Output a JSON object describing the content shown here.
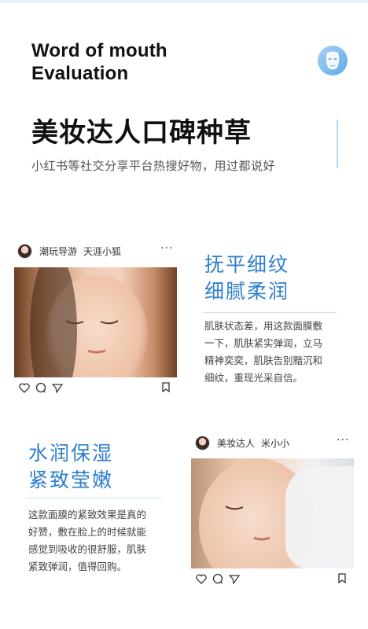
{
  "header": {
    "title_line1": "Word of mouth",
    "title_line2": "Evaluation",
    "icon": "face-mask-icon"
  },
  "hero": {
    "headline": "美妆达人口碑种草",
    "subhead": "小红书等社交分享平台热搜好物，用过都说好"
  },
  "post1": {
    "user": "潮玩导游",
    "name": "天涯小狐",
    "more": "···",
    "feature_line1": "抚平细纹",
    "feature_line2": "细腻柔润",
    "body_lines": [
      "肌肤状态差，用这款面膜敷",
      "一下，肌肤紧实弹润，立马",
      "精神奕奕，肌肤告别黯沉和",
      "细纹，重现光采自信。"
    ]
  },
  "post2": {
    "user": "美妆达人",
    "name": "米小小",
    "more": "···",
    "feature_line1": "水润保湿",
    "feature_line2": "紧致莹嫩",
    "body_lines": [
      "这款面膜的紧致效果是真的",
      "好赞，敷在脸上的时候就能",
      "感觉到吸收的很舒服，肌肤",
      "紧致弹润，值得回购。"
    ]
  },
  "colors": {
    "accent": "#2f7fd0",
    "rule": "#cfe3f6"
  }
}
